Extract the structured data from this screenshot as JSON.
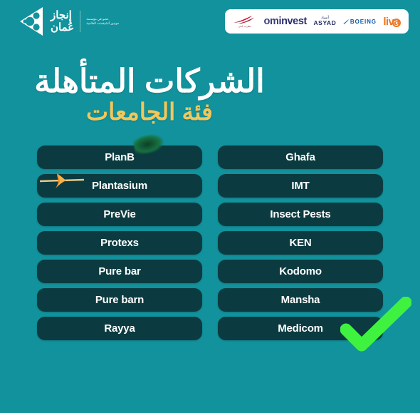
{
  "brand": {
    "name_line1": "إنجاز",
    "name_line2": "عُمان",
    "tagline_line1": "عضو في مؤسسة",
    "tagline_line2": "جونيور أتشيفمنت العالمية",
    "logo_icon": "sierpinski-triangle-logo"
  },
  "sponsors": {
    "items": [
      {
        "id": "oman-airports",
        "label": "مطارات عُمان",
        "icon": "oman-airports-swoosh-icon",
        "color": "#9a1d32"
      },
      {
        "id": "ominvest",
        "label_light": "om",
        "label_bold": "invest",
        "color": "#2b2e6e"
      },
      {
        "id": "asyad",
        "label_ar": "أسياد",
        "label_en": "ASYAD",
        "color": "#1b2a5e"
      },
      {
        "id": "boeing",
        "label": "BOEING",
        "icon": "boeing-swoosh-icon",
        "color": "#1059a8"
      },
      {
        "id": "liva",
        "label": "liva",
        "icon": "liva-ring-icon",
        "color": "#ef7622"
      }
    ]
  },
  "headline": {
    "line1": "الشركات المتأهلة",
    "line2": "فئة الجامعات",
    "line1_color": "#ffffff",
    "line2_color": "#f2c75c",
    "decor_green": "green-brush-blob",
    "decor_orange": "orange-arrow-brush"
  },
  "companies": {
    "left_column": [
      {
        "name": "PlanB"
      },
      {
        "name": "Plantasium"
      },
      {
        "name": "PreVie"
      },
      {
        "name": "Protexs"
      },
      {
        "name": "Pure bar"
      },
      {
        "name": "Pure barn"
      },
      {
        "name": "Rayya"
      }
    ],
    "right_column": [
      {
        "name": "Ghafa"
      },
      {
        "name": "IMT"
      },
      {
        "name": "Insect Pests"
      },
      {
        "name": "KEN"
      },
      {
        "name": "Kodomo"
      },
      {
        "name": "Mansha"
      },
      {
        "name": "Medicom"
      }
    ]
  },
  "overlay": {
    "check_icon": "green-checkmark-icon",
    "check_color": "#3ff23f"
  },
  "theme": {
    "background": "#12929c",
    "pill_background": "#0b3b40",
    "pill_text": "#ffffff",
    "accent_gold": "#f2c75c"
  }
}
